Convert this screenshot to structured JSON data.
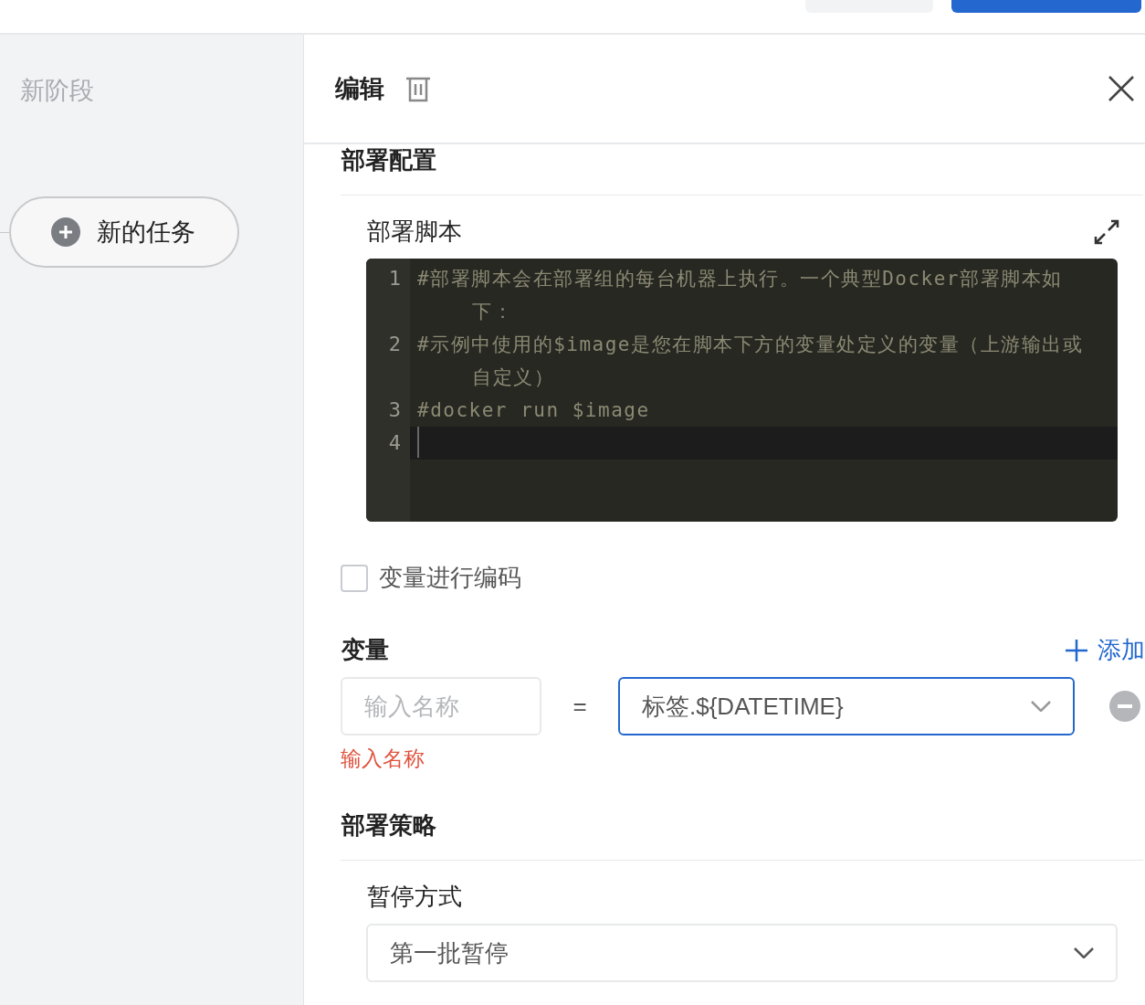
{
  "sidebar": {
    "stage_title": "新阶段",
    "task_button": "新的任务"
  },
  "panel": {
    "title": "编辑",
    "deploy_config": {
      "heading": "部署配置",
      "script_label": "部署脚本",
      "lines": [
        {
          "number": "1",
          "text": "#部署脚本会在部署组的每台机器上执行。一个典型Docker部署脚本如下：",
          "active": false
        },
        {
          "number": "2",
          "text": "#示例中使用的$image是您在脚本下方的变量处定义的变量（上游输出或自定义）",
          "active": false
        },
        {
          "number": "3",
          "text": "#docker run $image",
          "active": false
        },
        {
          "number": "4",
          "active": true
        }
      ],
      "encode_checkbox": {
        "label": "变量进行编码",
        "checked": false
      }
    },
    "variables": {
      "heading": "变量",
      "add_link": "添加",
      "rows": [
        {
          "name_placeholder": "输入名称",
          "equals": "=",
          "value": "标签.${DATETIME}",
          "error": "输入名称"
        }
      ]
    },
    "strategy": {
      "heading": "部署策略",
      "pause_label": "暂停方式",
      "pause_value": "第一批暂停"
    }
  }
}
